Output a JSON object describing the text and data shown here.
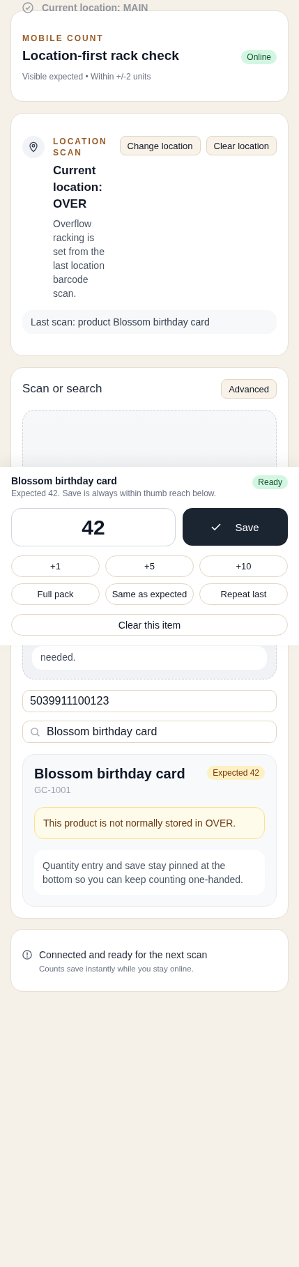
{
  "banner": {
    "text": "Current location: MAIN"
  },
  "header": {
    "eyebrow": "MOBILE COUNT",
    "title": "Location-first rack check",
    "status": "Online",
    "meta": "Visible expected • Within +/-2 units"
  },
  "location": {
    "eyebrow": "LOCATION SCAN",
    "title": "Current location: OVER",
    "description": "Overflow racking is set from the last location barcode scan.",
    "actions": [
      "Change location",
      "Clear location"
    ],
    "last_scan": "Last scan: product Blossom birthday card"
  },
  "scan": {
    "title": "Scan or search",
    "advanced": "Advanced",
    "drop_hint": "needed.",
    "barcode": "5039911100123",
    "search": "Blossom birthday card",
    "product": {
      "name": "Blossom birthday card",
      "sku": "GC-1001",
      "badge": "Expected 42",
      "warning": "This product is not normally stored in OVER.",
      "note": "Quantity entry and save stay pinned at the bottom so you can keep counting one-handed."
    }
  },
  "status": {
    "title": "Connected and ready for the next scan",
    "detail": "Counts save instantly while you stay online."
  },
  "quantity_panel": {
    "product": "Blossom birthday card",
    "hint": "Expected 42. Save is always within thumb reach below.",
    "status": "Ready",
    "quantity": "42",
    "save": "Save",
    "quick": [
      "+1",
      "+5",
      "+10",
      "Full pack",
      "Same as expected",
      "Repeat last"
    ],
    "clear": "Clear this item"
  }
}
